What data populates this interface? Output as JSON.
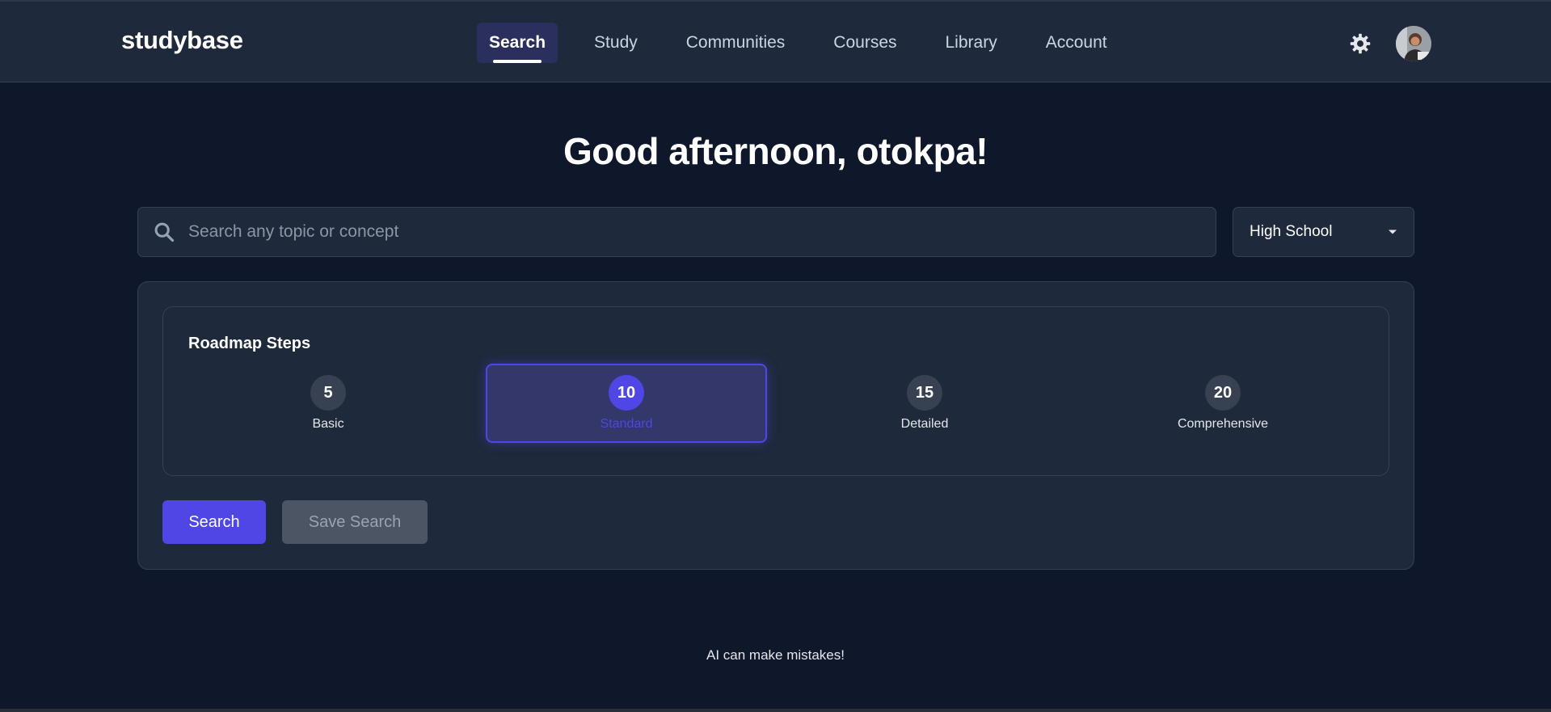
{
  "app": {
    "brand": "studybase"
  },
  "nav": {
    "items": [
      {
        "label": "Search",
        "active": true
      },
      {
        "label": "Study",
        "active": false
      },
      {
        "label": "Communities",
        "active": false
      },
      {
        "label": "Courses",
        "active": false
      },
      {
        "label": "Library",
        "active": false
      },
      {
        "label": "Account",
        "active": false
      }
    ],
    "icons": {
      "settings": "gear-icon",
      "avatar": "user-avatar"
    }
  },
  "main": {
    "greeting": "Good afternoon, otokpa!",
    "search": {
      "placeholder": "Search any topic or concept",
      "value": ""
    },
    "level": {
      "selected": "High School"
    },
    "roadmap": {
      "title": "Roadmap Steps",
      "selected_index": 1,
      "options": [
        {
          "count": "5",
          "label": "Basic"
        },
        {
          "count": "10",
          "label": "Standard"
        },
        {
          "count": "15",
          "label": "Detailed"
        },
        {
          "count": "20",
          "label": "Comprehensive"
        }
      ]
    },
    "buttons": {
      "search": "Search",
      "save": "Save Search"
    },
    "disclaimer": "AI can make mistakes!"
  },
  "colors": {
    "background": "#0f172a",
    "surface": "#1e293b",
    "accent": "#4f46e5",
    "border": "#334155"
  }
}
